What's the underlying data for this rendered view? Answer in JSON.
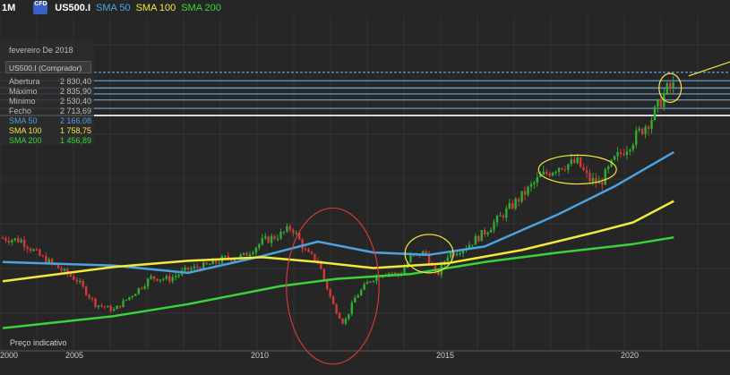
{
  "header": {
    "timeframe": "1M",
    "cfd_badge": "CFD",
    "symbol": "US500.I",
    "sma50_label": "SMA 50",
    "sma100_label": "SMA 100",
    "sma200_label": "SMA 200"
  },
  "info_panel": {
    "date": "fevereiro De 2018",
    "instrument": "US500.I (Comprador)",
    "rows": [
      {
        "label": "Abertura",
        "value": "2 830,40"
      },
      {
        "label": "Máximo",
        "value": "2 835,90"
      },
      {
        "label": "Mínimo",
        "value": "2 530,40"
      },
      {
        "label": "Fecho",
        "value": "2 713,69"
      },
      {
        "label": "SMA 50",
        "value": "2 166,08"
      },
      {
        "label": "SMA 100",
        "value": "1 758,75"
      },
      {
        "label": "SMA 200",
        "value": "1 456,89"
      }
    ]
  },
  "footer_note": "Preço indicativo",
  "colors": {
    "background": "#262626",
    "grid": "#333333",
    "candle_up": "#2fae2f",
    "candle_down": "#d23a3a",
    "sma50": "#4aa3e0",
    "sma100": "#f2e93a",
    "sma200": "#3ad43a",
    "annotation_red": "#d23a3a",
    "annotation_yellow": "#f2e93a",
    "level_lines": "#6aa8e0"
  },
  "chart_data": {
    "type": "candlestick",
    "x_axis_ticks": [
      "2000",
      "2005",
      "2010",
      "2015",
      "2020"
    ],
    "x_range": [
      2000,
      2022
    ],
    "y_range": [
      600,
      3000
    ],
    "grid": true,
    "candle_series": {
      "name": "US500.I",
      "points": [
        [
          2000.0,
          1450
        ],
        [
          2000.5,
          1430
        ],
        [
          2001.0,
          1300
        ],
        [
          2001.5,
          1200
        ],
        [
          2002.0,
          1100
        ],
        [
          2002.5,
          900
        ],
        [
          2003.0,
          850
        ],
        [
          2003.5,
          980
        ],
        [
          2004.0,
          1120
        ],
        [
          2004.5,
          1110
        ],
        [
          2005.0,
          1190
        ],
        [
          2005.5,
          1220
        ],
        [
          2006.0,
          1280
        ],
        [
          2006.5,
          1300
        ],
        [
          2007.0,
          1420
        ],
        [
          2007.5,
          1480
        ],
        [
          2007.8,
          1540
        ],
        [
          2008.2,
          1320
        ],
        [
          2008.5,
          1260
        ],
        [
          2008.9,
          900
        ],
        [
          2009.2,
          735
        ],
        [
          2009.5,
          950
        ],
        [
          2009.9,
          1100
        ],
        [
          2010.3,
          1170
        ],
        [
          2010.7,
          1140
        ],
        [
          2011.0,
          1290
        ],
        [
          2011.4,
          1330
        ],
        [
          2011.7,
          1130
        ],
        [
          2012.0,
          1310
        ],
        [
          2012.5,
          1380
        ],
        [
          2013.0,
          1500
        ],
        [
          2013.5,
          1650
        ],
        [
          2014.0,
          1800
        ],
        [
          2014.5,
          1960
        ],
        [
          2015.0,
          2050
        ],
        [
          2015.5,
          2080
        ],
        [
          2015.8,
          1940
        ],
        [
          2016.1,
          1900
        ],
        [
          2016.5,
          2100
        ],
        [
          2017.0,
          2270
        ],
        [
          2017.5,
          2450
        ],
        [
          2017.9,
          2680
        ],
        [
          2018.1,
          2713
        ]
      ]
    },
    "sma_series": [
      {
        "name": "SMA 50",
        "points": [
          [
            2000.0,
            1250
          ],
          [
            2003.0,
            1220
          ],
          [
            2005.0,
            1160
          ],
          [
            2007.0,
            1300
          ],
          [
            2008.5,
            1420
          ],
          [
            2010.0,
            1330
          ],
          [
            2011.5,
            1310
          ],
          [
            2013.0,
            1380
          ],
          [
            2015.0,
            1650
          ],
          [
            2016.5,
            1880
          ],
          [
            2018.1,
            2166
          ]
        ]
      },
      {
        "name": "SMA 100",
        "points": [
          [
            2000.0,
            1090
          ],
          [
            2003.0,
            1210
          ],
          [
            2005.0,
            1260
          ],
          [
            2007.0,
            1290
          ],
          [
            2008.5,
            1250
          ],
          [
            2010.0,
            1200
          ],
          [
            2012.0,
            1240
          ],
          [
            2014.0,
            1350
          ],
          [
            2016.0,
            1500
          ],
          [
            2017.0,
            1580
          ],
          [
            2018.1,
            1758
          ]
        ]
      },
      {
        "name": "SMA 200",
        "points": [
          [
            2000.0,
            700
          ],
          [
            2003.0,
            800
          ],
          [
            2005.0,
            900
          ],
          [
            2007.5,
            1050
          ],
          [
            2009.0,
            1110
          ],
          [
            2011.0,
            1150
          ],
          [
            2013.0,
            1250
          ],
          [
            2015.0,
            1330
          ],
          [
            2017.0,
            1400
          ],
          [
            2018.1,
            1456
          ]
        ]
      }
    ],
    "level_lines": [
      2530,
      2600,
      2650,
      2700,
      2760,
      2830
    ],
    "annotations": [
      {
        "shape": "ellipse",
        "color": "red",
        "x_center": 2008.9,
        "y_center": 1050,
        "x_radius": 1.25,
        "y_radius": 650
      },
      {
        "shape": "ellipse",
        "color": "yellow",
        "x_center": 2011.5,
        "y_center": 1320,
        "x_radius": 0.65,
        "y_radius": 160
      },
      {
        "shape": "ellipse",
        "color": "yellow",
        "x_center": 2015.5,
        "y_center": 2020,
        "x_radius": 1.05,
        "y_radius": 120
      },
      {
        "shape": "ellipse",
        "color": "yellow",
        "x_center": 2018.0,
        "y_center": 2700,
        "x_radius": 0.3,
        "y_radius": 120
      },
      {
        "shape": "arrow",
        "color": "yellow",
        "from": [
          2018.5,
          2800
        ],
        "to": [
          2020.4,
          3000
        ]
      }
    ]
  }
}
